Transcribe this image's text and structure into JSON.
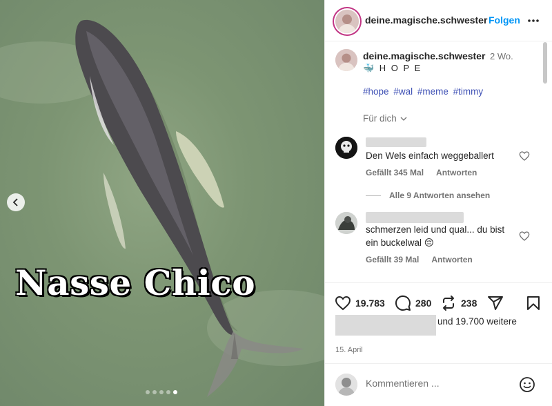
{
  "post": {
    "overlay_text": "Nasse Chico",
    "carousel": {
      "count": 5,
      "active_index": 4
    }
  },
  "header": {
    "username": "deine.magische.schwester",
    "follow_label": "Folgen"
  },
  "caption": {
    "username": "deine.magische.schwester",
    "time": "2 Wo.",
    "text": "🐳 H O P E",
    "hashtags": [
      "#hope",
      "#wal",
      "#meme",
      "#timmy"
    ],
    "for_you_label": "Für dich"
  },
  "comments": [
    {
      "text": "Den Wels einfach weggeballert",
      "likes": "Gefällt 345 Mal",
      "reply_label": "Antworten",
      "view_replies": "Alle 9 Antworten ansehen"
    },
    {
      "text": "schmerzen leid und qual... du bist ein buckelwal 😔",
      "likes": "Gefällt 39 Mal",
      "reply_label": "Antworten"
    }
  ],
  "actions": {
    "likes_count": "19.783",
    "comments_count": "280",
    "reposts_count": "238"
  },
  "liked_by_text": "und 19.700 weitere",
  "date": "15. April",
  "composer": {
    "placeholder": "Kommentieren ..."
  },
  "colors": {
    "link_blue": "#0095f6",
    "hashtag": "#3f51b5",
    "muted": "#737373",
    "water": "#7d9573"
  },
  "icons": [
    "chevron-left-icon",
    "more-icon",
    "heart-icon",
    "comment-icon",
    "repost-icon",
    "share-icon",
    "bookmark-icon",
    "chevron-down-icon",
    "emoji-icon"
  ]
}
